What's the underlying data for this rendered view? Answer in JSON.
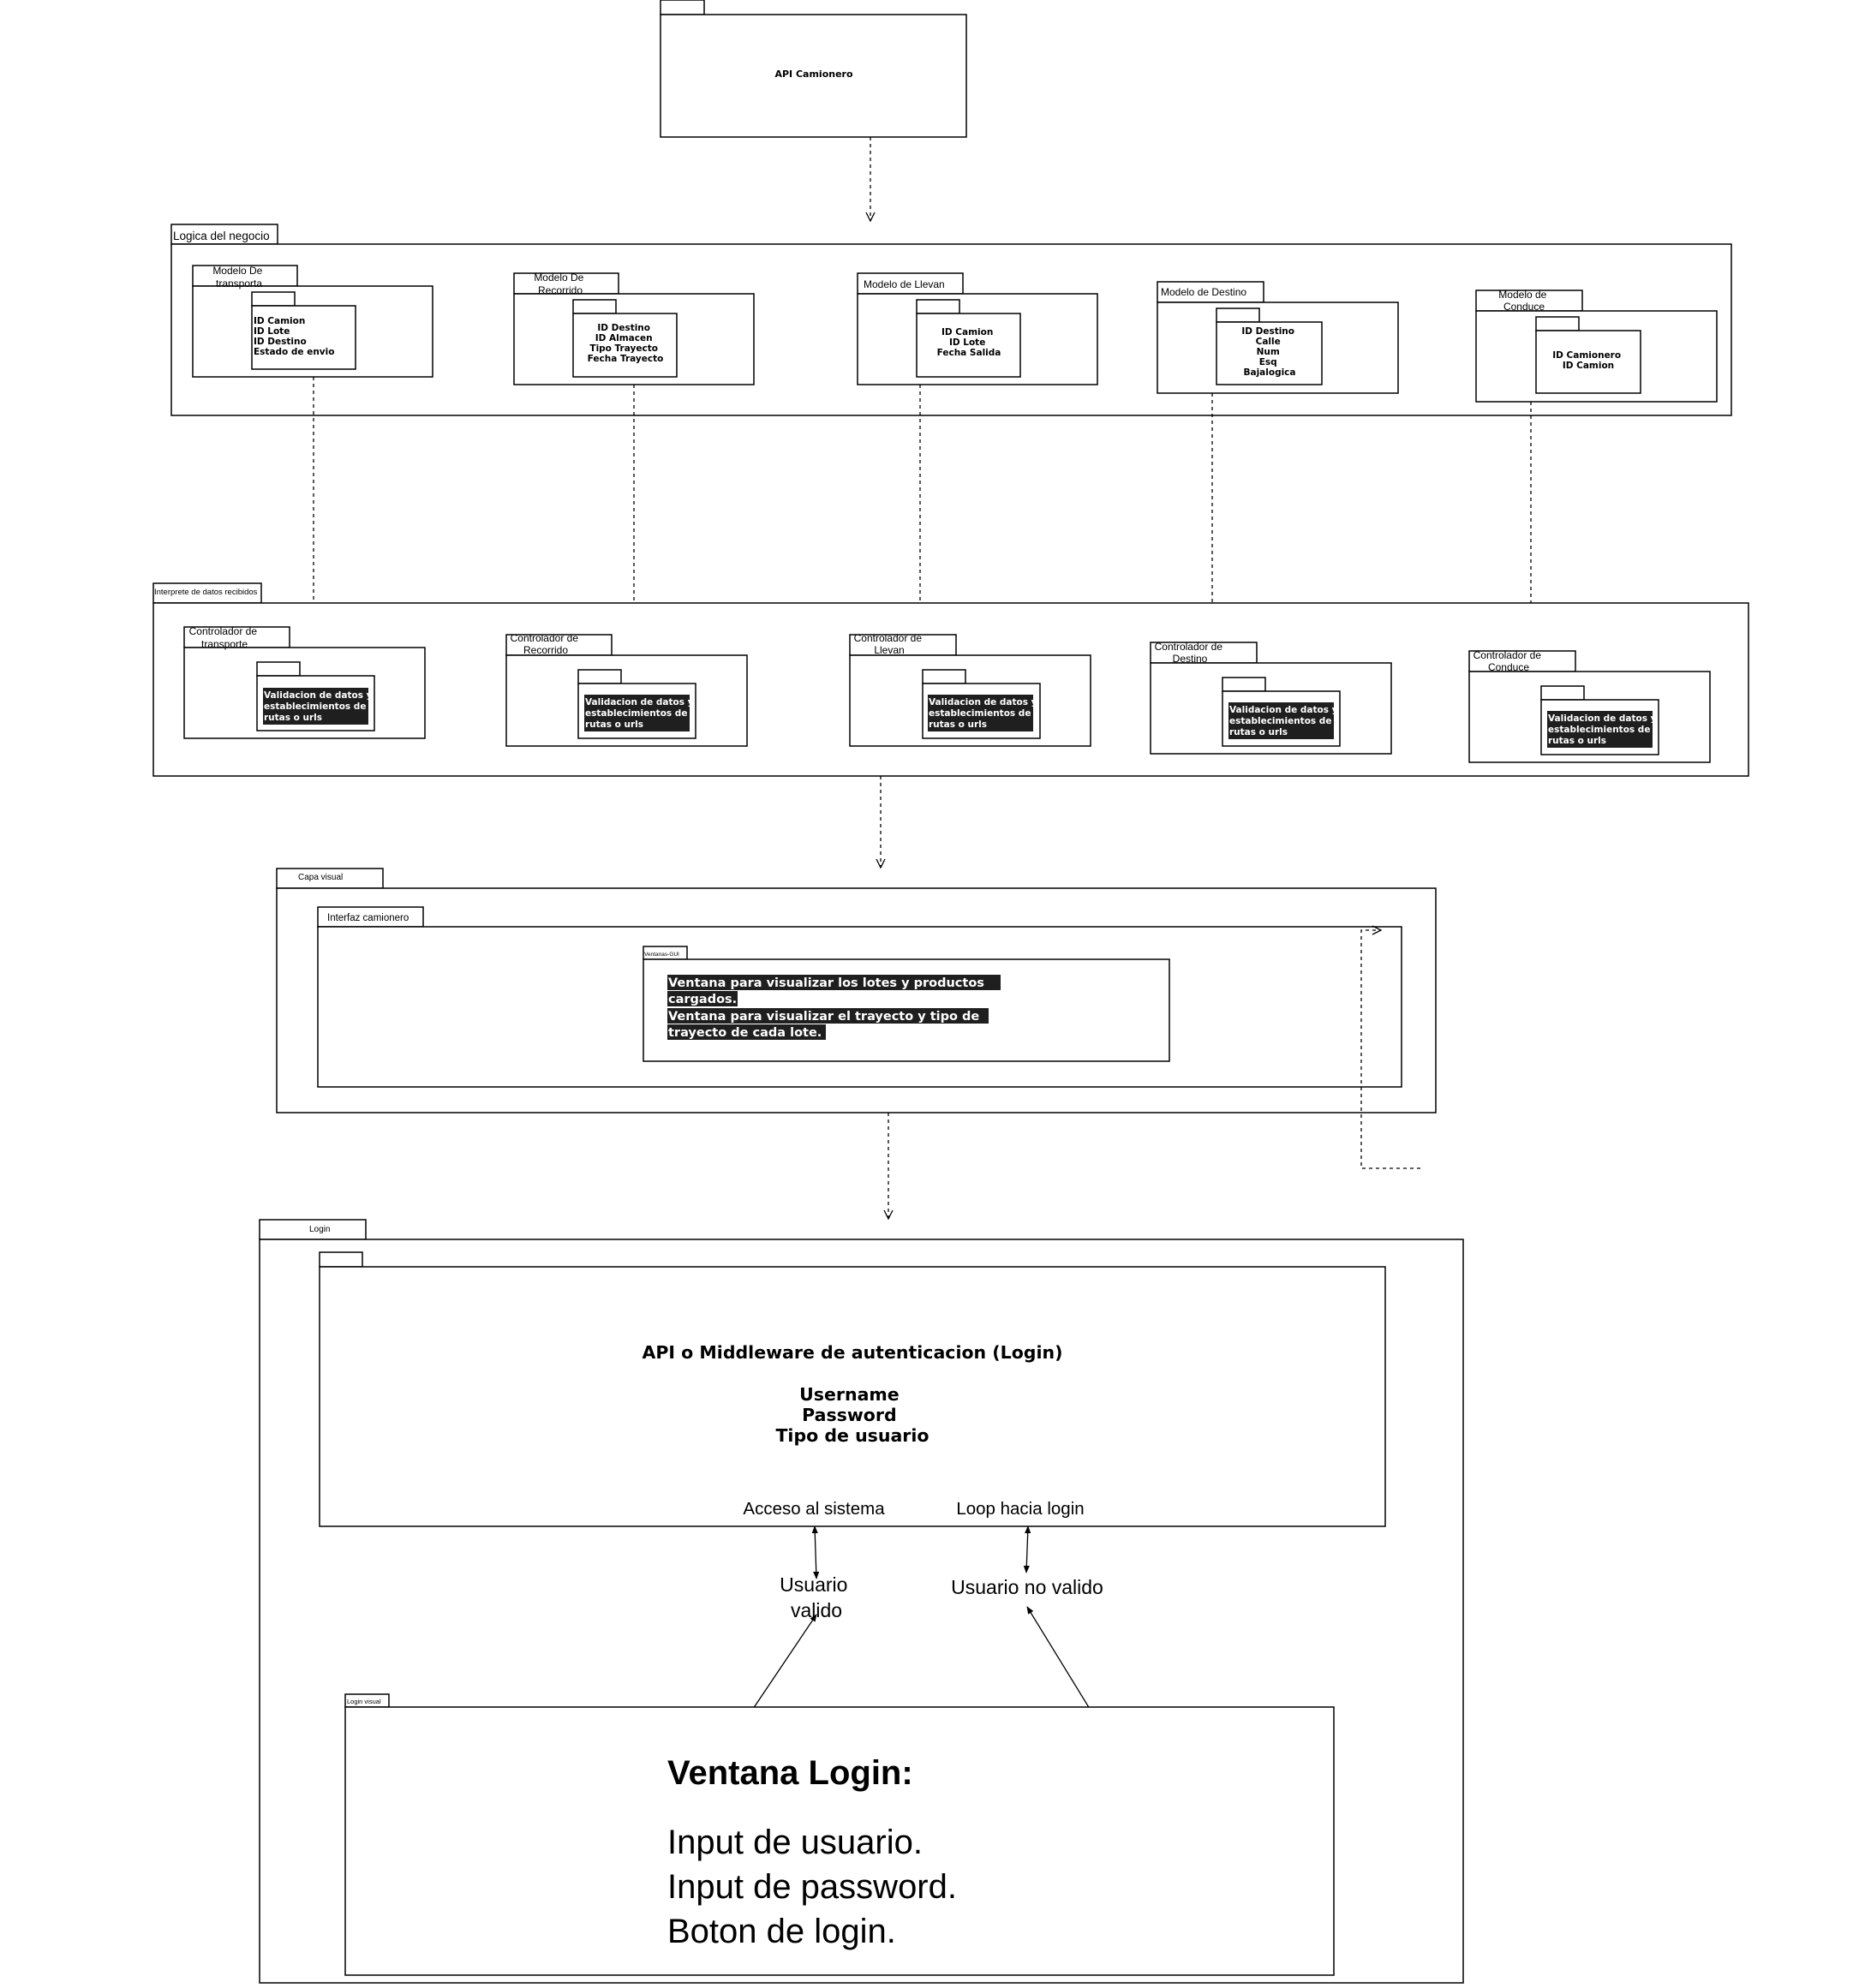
{
  "api_camionero": {
    "label": "API Camionero"
  },
  "logica": {
    "tab": "Logica del negocio",
    "models": [
      {
        "tab": [
          "Modelo De",
          "transporta"
        ],
        "fields": [
          "ID Camion",
          "ID Lote",
          "ID Destino",
          "Estado  de envio"
        ]
      },
      {
        "tab": [
          "Modelo De",
          "Recorrido"
        ],
        "fields": [
          "ID Destino",
          "ID Almacen",
          "Tipo Trayecto",
          "Fecha Trayecto"
        ]
      },
      {
        "tab": [
          "Modelo de Llevan"
        ],
        "fields": [
          "ID Camion",
          "ID Lote",
          "Fecha Salida"
        ]
      },
      {
        "tab": [
          "Modelo de Destino"
        ],
        "fields": [
          "ID Destino",
          "Calle",
          "Num",
          "Esq",
          "Bajalogica"
        ]
      },
      {
        "tab": [
          "Modelo de",
          "Conduce"
        ],
        "fields": [
          "ID Camionero",
          "ID Camion"
        ]
      }
    ]
  },
  "interprete": {
    "tab": "Interprete de datos recibidos",
    "controllers": [
      {
        "tab": [
          "Controlador de",
          "transporte"
        ]
      },
      {
        "tab": [
          "Controlador de",
          "Recorrido"
        ]
      },
      {
        "tab": [
          "Controlador de",
          "Llevan"
        ]
      },
      {
        "tab": [
          "Controlador de",
          "Destino"
        ]
      },
      {
        "tab": [
          "Controlador de",
          "Conduce"
        ]
      }
    ],
    "validation_text": [
      "Validacion de datos y",
      "establecimientos de",
      "rutas o urls"
    ]
  },
  "capa_visual": {
    "tab": "Capa visual",
    "interfaz_tab": "Interfaz camionero",
    "ventanas_tab": "Ventanas-GUI",
    "lines": [
      "Ventana para visualizar los lotes  y productos",
      "cargados.",
      "Ventana para visualizar el trayecto y tipo de",
      "trayecto de cada lote."
    ]
  },
  "login": {
    "tab": "Login",
    "auth_title": "API o Middleware de autenticacion  (Login)",
    "auth_fields": [
      "Username",
      "Password",
      "Tipo de usuario"
    ],
    "acceso_label": "Acceso al sistema",
    "loop_label": "Loop hacia login",
    "usuario_valido": [
      "Usuario",
      "valido"
    ],
    "usuario_no_valido": "Usuario no valido",
    "login_visual_tab": "Login visual",
    "ventana_title": "Ventana Login:",
    "ventana_items": [
      "Input de usuario.",
      "Input de password.",
      "Boton de login."
    ]
  }
}
